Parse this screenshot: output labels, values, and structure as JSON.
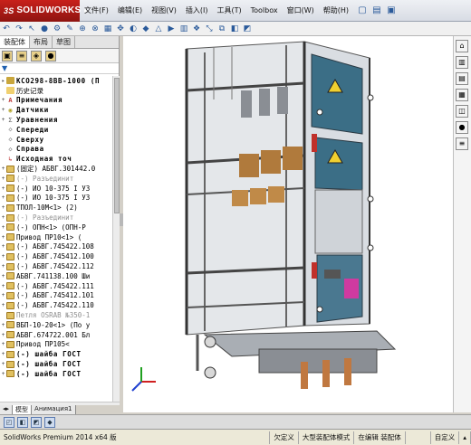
{
  "app": {
    "logo_text": "SOLIDWORKS",
    "logo_prefix": "3S"
  },
  "menu": [
    "文件(F)",
    "编辑(E)",
    "视图(V)",
    "插入(I)",
    "工具(T)",
    "Toolbox",
    "窗口(W)",
    "帮助(H)"
  ],
  "panel": {
    "tabs": [
      "装配体",
      "布局",
      "草图"
    ],
    "filter_glyph": "▼"
  },
  "tree": [
    {
      "exp": "▸",
      "icon": "asm",
      "text": "KCO298-8BB-1000 (П",
      "style": "t"
    },
    {
      "exp": "",
      "icon": "folder",
      "text": "历史记录",
      "style": ""
    },
    {
      "exp": "+",
      "icon": "note",
      "text": "Примечания",
      "style": "t"
    },
    {
      "exp": "+",
      "icon": "sensor",
      "text": "Датчики",
      "style": "t"
    },
    {
      "exp": "+",
      "icon": "eq",
      "text": "Уравнения",
      "style": "t"
    },
    {
      "exp": "",
      "icon": "plane",
      "text": "Спереди",
      "style": "t"
    },
    {
      "exp": "",
      "icon": "plane",
      "text": "Сверху",
      "style": "t"
    },
    {
      "exp": "",
      "icon": "plane",
      "text": "Справа",
      "style": "t"
    },
    {
      "exp": "",
      "icon": "origin",
      "text": "Исходная точ",
      "style": "t"
    },
    {
      "exp": "+",
      "icon": "part",
      "text": "(固定) АБВГ.301442.0",
      "style": ""
    },
    {
      "exp": "+",
      "icon": "part",
      "text": "(-) Разъединит",
      "style": "dim"
    },
    {
      "exp": "+",
      "icon": "part",
      "text": "(-) ИО 10-375 I У3",
      "style": ""
    },
    {
      "exp": "+",
      "icon": "part",
      "text": "(-) ИО 10-375 I У3",
      "style": ""
    },
    {
      "exp": "+",
      "icon": "part",
      "text": "ТПОЛ-10М<1> (2)",
      "style": ""
    },
    {
      "exp": "+",
      "icon": "part",
      "text": "(-) Разъединит",
      "style": "dim"
    },
    {
      "exp": "+",
      "icon": "part",
      "text": "(-) ОПН<1> (ОПН-Р",
      "style": ""
    },
    {
      "exp": "+",
      "icon": "part",
      "text": "Привод ПР10<1> (",
      "style": ""
    },
    {
      "exp": "+",
      "icon": "part",
      "text": "(-) АБВГ.745422.108",
      "style": ""
    },
    {
      "exp": "+",
      "icon": "part",
      "text": "(-) АБВГ.745412.100",
      "style": ""
    },
    {
      "exp": "+",
      "icon": "part",
      "text": "(-) АБВГ.745422.112",
      "style": ""
    },
    {
      "exp": "+",
      "icon": "part",
      "text": "АБВГ.741138.100 Ши",
      "style": ""
    },
    {
      "exp": "+",
      "icon": "part",
      "text": "(-) АБВГ.745422.111",
      "style": ""
    },
    {
      "exp": "+",
      "icon": "part",
      "text": "(-) АБВГ.745412.101",
      "style": ""
    },
    {
      "exp": "+",
      "icon": "part",
      "text": "(-) АБВГ.745422.110",
      "style": ""
    },
    {
      "exp": "",
      "icon": "part",
      "text": "Петля OSRAB №350-1",
      "style": "dim"
    },
    {
      "exp": "+",
      "icon": "part",
      "text": "ВБП-10-20<1> (По у",
      "style": ""
    },
    {
      "exp": "+",
      "icon": "part",
      "text": "АБВГ.674722.001 Бл",
      "style": ""
    },
    {
      "exp": "+",
      "icon": "part",
      "text": "Привод ПР105<",
      "style": ""
    },
    {
      "exp": "+",
      "icon": "part",
      "text": "(-) шайба ГОСТ",
      "style": "t"
    },
    {
      "exp": "+",
      "icon": "part",
      "text": "(-) шайба ГОСТ",
      "style": "t"
    },
    {
      "exp": "+",
      "icon": "part",
      "text": "(-) шайба ГОСТ",
      "style": "t"
    }
  ],
  "bottom_tabs": [
    "模型",
    "Анимация1"
  ],
  "status": {
    "left": "SolidWorks Premium 2014 x64 版",
    "items": [
      "欠定义",
      "大型装配体模式",
      "在编辑 装配体",
      "",
      "自定义"
    ]
  }
}
